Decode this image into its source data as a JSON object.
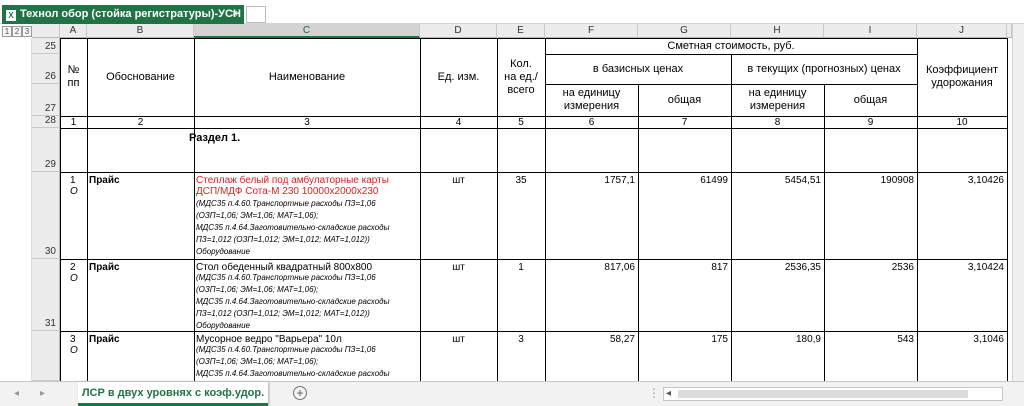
{
  "window": {
    "title": "Технол обор (стойка регистратуры)-УСН",
    "close_glyph": "×",
    "xl_glyph": "X"
  },
  "outline_levels": [
    "1",
    "2",
    "3"
  ],
  "columns": [
    "A",
    "B",
    "C",
    "D",
    "E",
    "F",
    "G",
    "H",
    "I",
    "J"
  ],
  "rows": [
    "25",
    "26",
    "27",
    "28",
    "29",
    "30",
    "31"
  ],
  "header": {
    "num": "№\nпп",
    "basis": "Обоснование",
    "name": "Наименование",
    "unit": "Ед. изм.",
    "qty": "Кол.\nна ед./\nвсего",
    "estimate": "Сметная стоимость, руб.",
    "base_prices": "в базисных ценах",
    "current_prices": "в текущих (прогнозных) ценах",
    "per_unit": "на единицу\nизмерения",
    "total": "общая",
    "coef": "Коэффициент\nудорожания"
  },
  "numbering": [
    "1",
    "2",
    "3",
    "4",
    "5",
    "6",
    "7",
    "8",
    "9",
    "10"
  ],
  "section": "Раздел 1.",
  "items": [
    {
      "num": "1",
      "sub": "О",
      "basis": "Прайс",
      "name_lines": [
        "Стеллаж белый под амбулаторные карты",
        "ДСП/МДФ Сота-М 230 10000х2000х230"
      ],
      "red": true,
      "notes": [
        "(МДС35 п.4.60.Транспортные расходы ПЗ=1,06",
        "(ОЗП=1,06; ЭМ=1,06; МАТ=1,06);",
        "МДС35 п.4.64.Заготовительно-складские расходы",
        "ПЗ=1,012 (ОЗП=1,012; ЭМ=1,012; МАТ=1,012))",
        "Оборудование"
      ],
      "unit": "шт",
      "qty": "35",
      "base_unit": "1757,1",
      "base_total": "61499",
      "cur_unit": "5454,51",
      "cur_total": "190908",
      "coef": "3,10426"
    },
    {
      "num": "2",
      "sub": "О",
      "basis": "Прайс",
      "name_lines": [
        "Стол обеденный квадратный 800х800"
      ],
      "red": false,
      "notes": [
        "(МДС35 п.4.60.Транспортные расходы ПЗ=1,06",
        "(ОЗП=1,06; ЭМ=1,06; МАТ=1,06);",
        "МДС35 п.4.64.Заготовительно-складские расходы",
        "ПЗ=1,012 (ОЗП=1,012; ЭМ=1,012; МАТ=1,012))",
        "Оборудование"
      ],
      "unit": "шт",
      "qty": "1",
      "base_unit": "817,06",
      "base_total": "817",
      "cur_unit": "2536,35",
      "cur_total": "2536",
      "coef": "3,10424"
    },
    {
      "num": "3",
      "sub": "О",
      "basis": "Прайс",
      "name_lines": [
        "Мусорное ведро \"Варьера\" 10л"
      ],
      "red": false,
      "notes": [
        "(МДС35 п.4.60.Транспортные расходы ПЗ=1,06",
        "(ОЗП=1,06; ЭМ=1,06; МАТ=1,06);",
        "МДС35 п.4.64.Заготовительно-складские расходы"
      ],
      "unit": "шт",
      "qty": "3",
      "base_unit": "58,27",
      "base_total": "175",
      "cur_unit": "180,9",
      "cur_total": "543",
      "coef": "3,1046"
    }
  ],
  "sheet_tab": "ЛСР в двух уровнях с коэф.удор.",
  "add_sheet": "+",
  "nav": {
    "prev": "◂",
    "next": "▸",
    "scroll_left": "◂"
  },
  "colors": {
    "excel_green": "#217346",
    "red_text": "#e02020"
  }
}
